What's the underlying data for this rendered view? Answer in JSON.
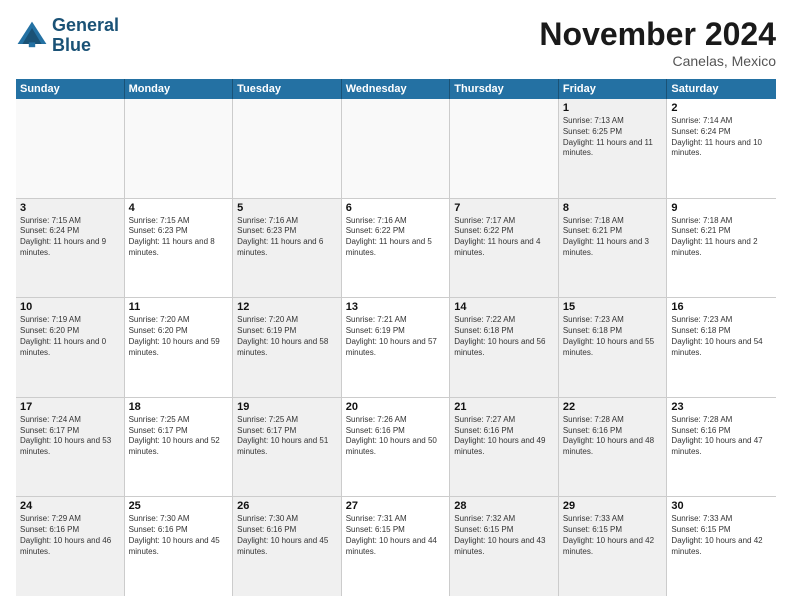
{
  "header": {
    "logo_line1": "General",
    "logo_line2": "Blue",
    "month": "November 2024",
    "location": "Canelas, Mexico"
  },
  "days_of_week": [
    "Sunday",
    "Monday",
    "Tuesday",
    "Wednesday",
    "Thursday",
    "Friday",
    "Saturday"
  ],
  "rows": [
    [
      {
        "day": "",
        "empty": true
      },
      {
        "day": "",
        "empty": true
      },
      {
        "day": "",
        "empty": true
      },
      {
        "day": "",
        "empty": true
      },
      {
        "day": "",
        "empty": true
      },
      {
        "day": "1",
        "shaded": true,
        "info": "Sunrise: 7:13 AM\nSunset: 6:25 PM\nDaylight: 11 hours and 11 minutes."
      },
      {
        "day": "2",
        "info": "Sunrise: 7:14 AM\nSunset: 6:24 PM\nDaylight: 11 hours and 10 minutes."
      }
    ],
    [
      {
        "day": "3",
        "shaded": true,
        "info": "Sunrise: 7:15 AM\nSunset: 6:24 PM\nDaylight: 11 hours and 9 minutes."
      },
      {
        "day": "4",
        "info": "Sunrise: 7:15 AM\nSunset: 6:23 PM\nDaylight: 11 hours and 8 minutes."
      },
      {
        "day": "5",
        "shaded": true,
        "info": "Sunrise: 7:16 AM\nSunset: 6:23 PM\nDaylight: 11 hours and 6 minutes."
      },
      {
        "day": "6",
        "info": "Sunrise: 7:16 AM\nSunset: 6:22 PM\nDaylight: 11 hours and 5 minutes."
      },
      {
        "day": "7",
        "shaded": true,
        "info": "Sunrise: 7:17 AM\nSunset: 6:22 PM\nDaylight: 11 hours and 4 minutes."
      },
      {
        "day": "8",
        "shaded": true,
        "info": "Sunrise: 7:18 AM\nSunset: 6:21 PM\nDaylight: 11 hours and 3 minutes."
      },
      {
        "day": "9",
        "info": "Sunrise: 7:18 AM\nSunset: 6:21 PM\nDaylight: 11 hours and 2 minutes."
      }
    ],
    [
      {
        "day": "10",
        "shaded": true,
        "info": "Sunrise: 7:19 AM\nSunset: 6:20 PM\nDaylight: 11 hours and 0 minutes."
      },
      {
        "day": "11",
        "info": "Sunrise: 7:20 AM\nSunset: 6:20 PM\nDaylight: 10 hours and 59 minutes."
      },
      {
        "day": "12",
        "shaded": true,
        "info": "Sunrise: 7:20 AM\nSunset: 6:19 PM\nDaylight: 10 hours and 58 minutes."
      },
      {
        "day": "13",
        "info": "Sunrise: 7:21 AM\nSunset: 6:19 PM\nDaylight: 10 hours and 57 minutes."
      },
      {
        "day": "14",
        "shaded": true,
        "info": "Sunrise: 7:22 AM\nSunset: 6:18 PM\nDaylight: 10 hours and 56 minutes."
      },
      {
        "day": "15",
        "shaded": true,
        "info": "Sunrise: 7:23 AM\nSunset: 6:18 PM\nDaylight: 10 hours and 55 minutes."
      },
      {
        "day": "16",
        "info": "Sunrise: 7:23 AM\nSunset: 6:18 PM\nDaylight: 10 hours and 54 minutes."
      }
    ],
    [
      {
        "day": "17",
        "shaded": true,
        "info": "Sunrise: 7:24 AM\nSunset: 6:17 PM\nDaylight: 10 hours and 53 minutes."
      },
      {
        "day": "18",
        "info": "Sunrise: 7:25 AM\nSunset: 6:17 PM\nDaylight: 10 hours and 52 minutes."
      },
      {
        "day": "19",
        "shaded": true,
        "info": "Sunrise: 7:25 AM\nSunset: 6:17 PM\nDaylight: 10 hours and 51 minutes."
      },
      {
        "day": "20",
        "info": "Sunrise: 7:26 AM\nSunset: 6:16 PM\nDaylight: 10 hours and 50 minutes."
      },
      {
        "day": "21",
        "shaded": true,
        "info": "Sunrise: 7:27 AM\nSunset: 6:16 PM\nDaylight: 10 hours and 49 minutes."
      },
      {
        "day": "22",
        "shaded": true,
        "info": "Sunrise: 7:28 AM\nSunset: 6:16 PM\nDaylight: 10 hours and 48 minutes."
      },
      {
        "day": "23",
        "info": "Sunrise: 7:28 AM\nSunset: 6:16 PM\nDaylight: 10 hours and 47 minutes."
      }
    ],
    [
      {
        "day": "24",
        "shaded": true,
        "info": "Sunrise: 7:29 AM\nSunset: 6:16 PM\nDaylight: 10 hours and 46 minutes."
      },
      {
        "day": "25",
        "info": "Sunrise: 7:30 AM\nSunset: 6:16 PM\nDaylight: 10 hours and 45 minutes."
      },
      {
        "day": "26",
        "shaded": true,
        "info": "Sunrise: 7:30 AM\nSunset: 6:16 PM\nDaylight: 10 hours and 45 minutes."
      },
      {
        "day": "27",
        "info": "Sunrise: 7:31 AM\nSunset: 6:15 PM\nDaylight: 10 hours and 44 minutes."
      },
      {
        "day": "28",
        "shaded": true,
        "info": "Sunrise: 7:32 AM\nSunset: 6:15 PM\nDaylight: 10 hours and 43 minutes."
      },
      {
        "day": "29",
        "shaded": true,
        "info": "Sunrise: 7:33 AM\nSunset: 6:15 PM\nDaylight: 10 hours and 42 minutes."
      },
      {
        "day": "30",
        "info": "Sunrise: 7:33 AM\nSunset: 6:15 PM\nDaylight: 10 hours and 42 minutes."
      }
    ]
  ]
}
